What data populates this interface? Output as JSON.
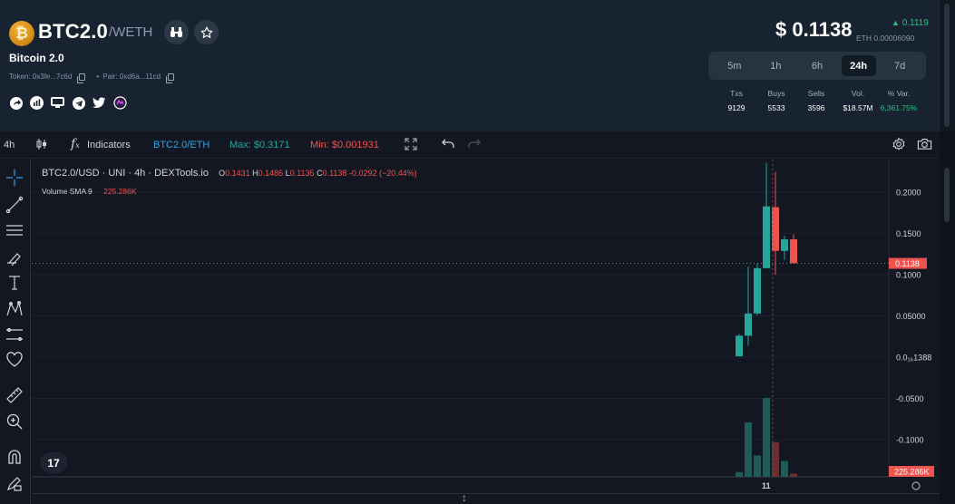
{
  "token": {
    "symbol": "BTC2.0",
    "quote": "/WETH",
    "name": "Bitcoin 2.0",
    "token_label": "Token: 0x3fe...7c6d",
    "pair_label": "Pair: 0xd6a...11cd",
    "logo_glyph": "₿"
  },
  "price": {
    "usd": "$ 0.1138",
    "change": "0.1119",
    "eth": "ETH 0.00006090"
  },
  "timeframes": [
    "5m",
    "1h",
    "6h",
    "24h",
    "7d"
  ],
  "active_timeframe": "24h",
  "stats": [
    {
      "label": "Txs",
      "value": "9129"
    },
    {
      "label": "Buys",
      "value": "5533"
    },
    {
      "label": "Sells",
      "value": "3596"
    },
    {
      "label": "Vol.",
      "value": "$18.57M"
    },
    {
      "label": "% Var.",
      "value": "6,361.75%"
    }
  ],
  "toolbar": {
    "interval": "4h",
    "indicators": "Indicators",
    "pair": "BTC2.0/ETH",
    "max": "Max: $0.3171",
    "min": "Min: $0.001931"
  },
  "legend": {
    "title": "BTC2.0/USD · UNI · 4h · DEXTools.io",
    "o_key": "O",
    "o": "0.1431",
    "h_key": "H",
    "h": "0.1486",
    "l_key": "L",
    "l": "0.1135",
    "c_key": "C",
    "c": "0.1138",
    "change": "-0.0292 (−20.44%)",
    "volume_label": "Volume SMA 9",
    "volume_value": "225.286K"
  },
  "tv_logo": "17",
  "colors": {
    "up": "#26a69a",
    "down": "#ef5350",
    "accent_green": "#26c281",
    "max_green": "#26a69a",
    "min_red": "#ef5350",
    "pair_blue": "#2ea6e6"
  },
  "chart_data": {
    "type": "candlestick",
    "interval": "4h",
    "y_ticks": [
      "0.2000",
      "0.1500",
      "0.1000",
      "0.05000",
      "0.0₁₆1388",
      "-0.0500",
      "-0.1000"
    ],
    "y_tick_values": [
      0.2,
      0.15,
      0.1,
      0.05,
      0.0,
      -0.05,
      -0.1
    ],
    "current_price_label": "0.1138",
    "current_price": 0.1138,
    "volume_label": "225.286K",
    "x_ticks": [
      "11"
    ],
    "candles": [
      {
        "open": 0.001,
        "high": 0.028,
        "low": 0.001,
        "close": 0.026
      },
      {
        "open": 0.026,
        "high": 0.11,
        "low": 0.014,
        "close": 0.053
      },
      {
        "open": 0.053,
        "high": 0.113,
        "low": 0.051,
        "close": 0.108
      },
      {
        "open": 0.108,
        "high": 0.236,
        "low": 0.108,
        "close": 0.183
      },
      {
        "open": 0.182,
        "high": 0.225,
        "low": 0.1,
        "close": 0.129
      },
      {
        "open": 0.129,
        "high": 0.147,
        "low": 0.118,
        "close": 0.143
      },
      {
        "open": 0.143,
        "high": 0.149,
        "low": 0.114,
        "close": 0.114
      }
    ],
    "volumes": [
      {
        "value": 0.06,
        "up": true
      },
      {
        "value": 0.69,
        "up": true
      },
      {
        "value": 0.27,
        "up": true
      },
      {
        "value": 1.0,
        "up": true
      },
      {
        "value": 0.44,
        "up": false
      },
      {
        "value": 0.2,
        "up": true
      },
      {
        "value": 0.04,
        "up": false
      }
    ]
  }
}
